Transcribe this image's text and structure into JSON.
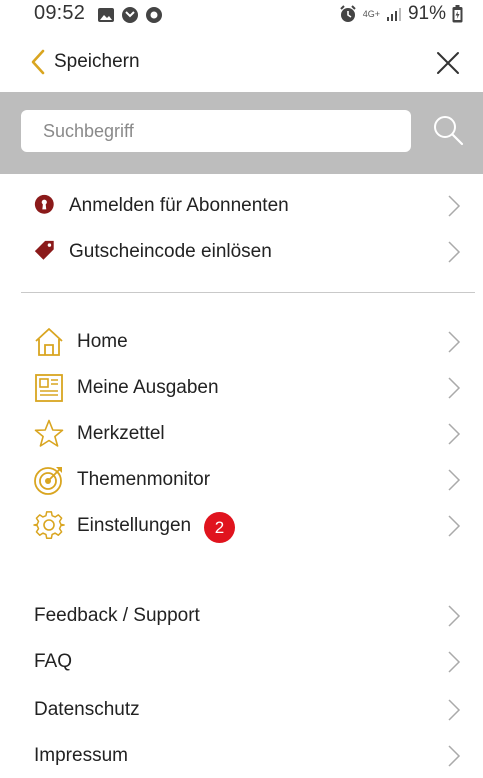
{
  "status_bar": {
    "time": "09:52",
    "network": "4G+",
    "battery": "91%",
    "icons": [
      "image-icon",
      "notification-icon",
      "notification-icon-2",
      "alarm-icon",
      "network-icon",
      "signal-icon",
      "battery-icon"
    ]
  },
  "header": {
    "back_label": "Speichern",
    "icons": [
      "chevron-left-icon",
      "close-icon"
    ]
  },
  "search": {
    "placeholder": "Suchbegriff",
    "value": ""
  },
  "account_items": [
    {
      "label": "Anmelden für Abonnenten",
      "icon": "keyhole-icon"
    },
    {
      "label": "Gutscheincode einlösen",
      "icon": "tag-icon"
    }
  ],
  "main_items": [
    {
      "label": "Home",
      "icon": "home-icon"
    },
    {
      "label": "Meine Ausgaben",
      "icon": "newspaper-icon"
    },
    {
      "label": "Merkzettel",
      "icon": "star-icon"
    },
    {
      "label": "Themenmonitor",
      "icon": "target-icon"
    },
    {
      "label": "Einstellungen",
      "icon": "gear-icon",
      "badge": "2"
    }
  ],
  "info_items": [
    {
      "label": "Feedback / Support"
    },
    {
      "label": "FAQ"
    },
    {
      "label": "Datenschutz"
    },
    {
      "label": "Impressum"
    }
  ],
  "colors": {
    "accent": "#d9a520",
    "dark_red": "#8b1a1a",
    "badge": "#e0141e",
    "search_band": "#bdbdbd"
  }
}
